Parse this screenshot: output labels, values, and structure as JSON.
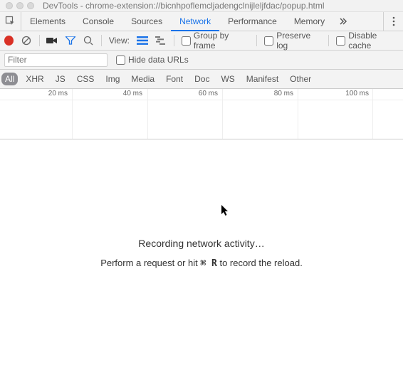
{
  "title": "DevTools - chrome-extension://bicnhpoflemcljadengclnijleljfdac/popup.html",
  "tabs": [
    "Elements",
    "Console",
    "Sources",
    "Network",
    "Performance",
    "Memory"
  ],
  "activeTab": "Network",
  "toolbar": {
    "viewLabel": "View:",
    "groupByFrame": "Group by frame",
    "preserveLog": "Preserve log",
    "disableCache": "Disable cache"
  },
  "filter": {
    "placeholder": "Filter",
    "hideDataUrls": "Hide data URLs"
  },
  "types": [
    "All",
    "XHR",
    "JS",
    "CSS",
    "Img",
    "Media",
    "Font",
    "Doc",
    "WS",
    "Manifest",
    "Other"
  ],
  "timeline": {
    "ticks": [
      "20 ms",
      "40 ms",
      "60 ms",
      "80 ms",
      "100 ms"
    ]
  },
  "empty": {
    "title": "Recording network activity…",
    "prefix": "Perform a request or hit ",
    "hotkey": "⌘ R",
    "suffix": " to record the reload."
  },
  "colors": {
    "accent": "#1a73e8",
    "recording": "#d93025"
  }
}
